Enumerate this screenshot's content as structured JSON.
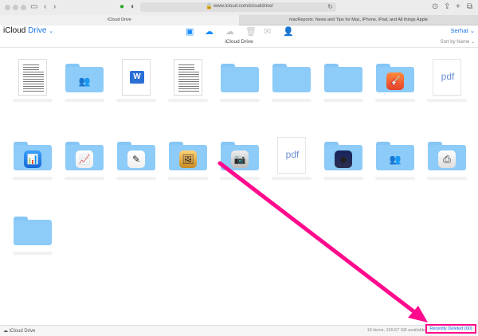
{
  "browser": {
    "url": "www.icloud.com/iclouddrive/",
    "tabs": [
      {
        "label": "iCloud Drive"
      },
      {
        "label": "macReports: News and Tips for Mac, iPhone, iPad, and All things Apple"
      }
    ]
  },
  "header": {
    "brand_prefix": "iCloud",
    "brand_name": "Drive",
    "user": "Serhat",
    "page_title": "iCloud Drive",
    "sort_label": "Sort by Name"
  },
  "items": [
    {
      "kind": "doc",
      "icon": "document-text-icon"
    },
    {
      "kind": "folder",
      "icon": "shared-people-icon"
    },
    {
      "kind": "doc",
      "icon": "word-document-icon"
    },
    {
      "kind": "doc",
      "icon": "document-text-icon"
    },
    {
      "kind": "folder",
      "icon": ""
    },
    {
      "kind": "folder",
      "icon": ""
    },
    {
      "kind": "folder",
      "icon": ""
    },
    {
      "kind": "folder",
      "icon": "garageband-icon"
    },
    {
      "kind": "pdf",
      "icon": "pdf-icon",
      "text": "pdf"
    },
    {
      "kind": "folder",
      "icon": "keynote-icon"
    },
    {
      "kind": "folder",
      "icon": "numbers-icon"
    },
    {
      "kind": "folder",
      "icon": "pages-icon"
    },
    {
      "kind": "folder",
      "icon": "preview-icon"
    },
    {
      "kind": "folder",
      "icon": "image-capture-icon"
    },
    {
      "kind": "pdf",
      "icon": "pdf-icon",
      "text": "pdf"
    },
    {
      "kind": "folder",
      "icon": "shortcuts-icon"
    },
    {
      "kind": "folder",
      "icon": "shared-people-icon"
    },
    {
      "kind": "folder",
      "icon": "scanner-icon"
    },
    {
      "kind": "folder",
      "icon": ""
    }
  ],
  "status": {
    "left": "iCloud Drive",
    "count": "19 items, 109.67 GB available",
    "recently_deleted": "Recently Deleted (60)"
  },
  "colors": {
    "accent": "#1a73e8",
    "folder": "#8dcbf8",
    "highlight": "#ff0a8c"
  }
}
